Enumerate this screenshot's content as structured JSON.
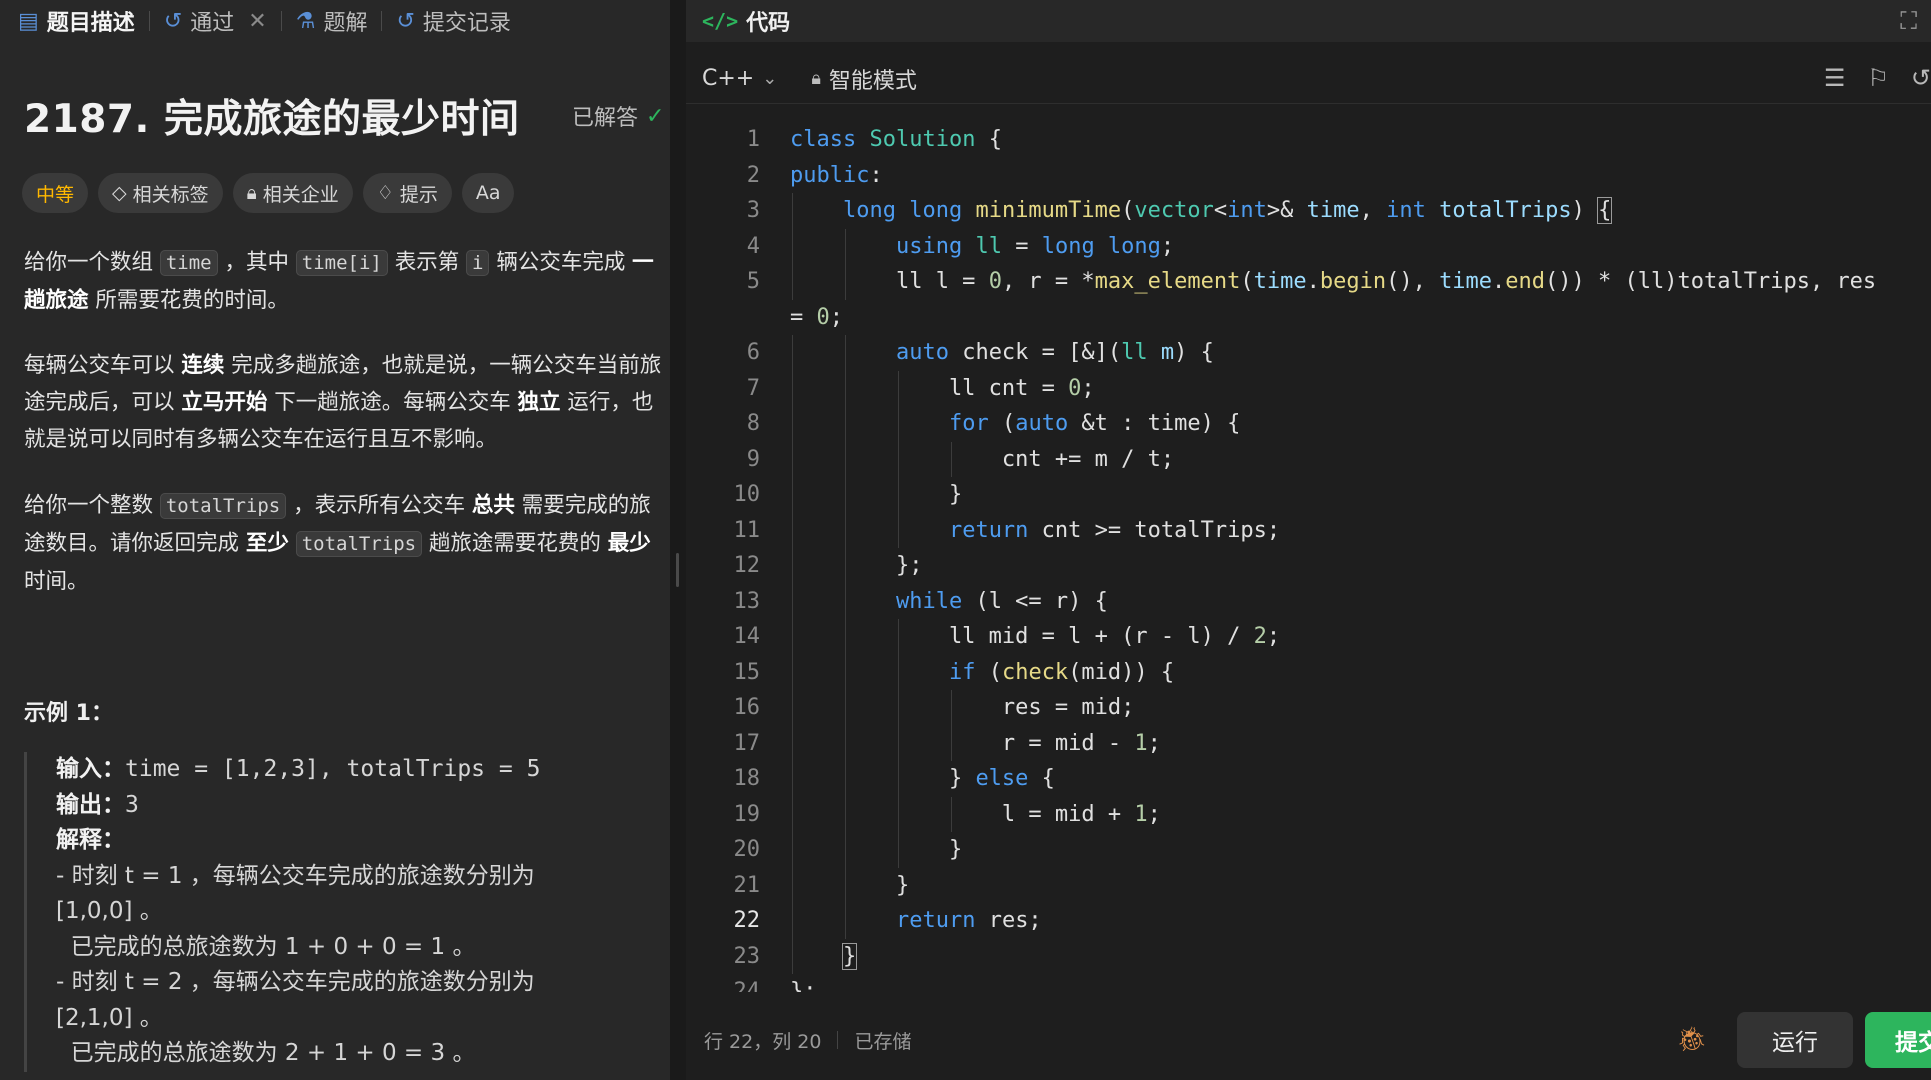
{
  "left_tabs": [
    {
      "label": "题目描述",
      "icon": "doc-icon"
    },
    {
      "label": "通过",
      "icon": "history-icon"
    },
    {
      "label": "题解",
      "icon": "flask-icon"
    },
    {
      "label": "提交记录",
      "icon": "history-icon"
    }
  ],
  "problem": {
    "title": "2187. 完成旅途的最少时间",
    "status": "已解答",
    "difficulty": "中等",
    "tags": [
      "相关标签",
      "相关企业",
      "提示",
      "Aa"
    ]
  },
  "description": {
    "p1_a": "给你一个数组 ",
    "p1_code1": "time",
    "p1_b": " ，其中 ",
    "p1_code2": "time[i]",
    "p1_c": " 表示第 ",
    "p1_code3": "i",
    "p1_d": " 辆公交车完成 ",
    "p1_bold": "一趟旅途",
    "p1_e": " 所需要花费的时间。",
    "p2_a": "每辆公交车可以 ",
    "p2_b1": "连续",
    "p2_b": " 完成多趟旅途，也就是说，一辆公交车当前旅途完成后，可以 ",
    "p2_b2": "立马开始",
    "p2_c": " 下一趟旅途。每辆公交车 ",
    "p2_b3": "独立",
    "p2_d": " 运行，也就是说可以同时有多辆公交车在运行且互不影响。",
    "p3_a": "给你一个整数 ",
    "p3_code1": "totalTrips",
    "p3_b": " ，表示所有公交车 ",
    "p3_b1": "总共",
    "p3_c": " 需要完成的旅途数目。请你返回完成 ",
    "p3_b2": "至少",
    "p3_code2": "totalTrips",
    "p3_d": " 趟旅途需要花费的 ",
    "p3_b3": "最少",
    "p3_e": " 时间。"
  },
  "example": {
    "title": "示例 1：",
    "input_label": "输入：",
    "input_value": "time = [1,2,3], totalTrips = 5",
    "output_label": "输出：",
    "output_value": "3",
    "explain_label": "解释：",
    "lines": [
      "- 时刻 t = 1 ，每辆公交车完成的旅途数分别为",
      "[1,0,0] 。",
      "  已完成的总旅途数为 1 + 0 + 0 = 1 。",
      "- 时刻 t = 2 ，每辆公交车完成的旅途数分别为",
      "[2,1,0] 。",
      "  已完成的总旅途数为 2 + 1 + 0 = 3 。"
    ]
  },
  "editor": {
    "header": "代码",
    "language": "C++",
    "mode": "智能模式",
    "status_pos": "行 22，列 20",
    "status_saved": "已存储",
    "run_label": "运行",
    "submit_label": "提交",
    "current_line": 22
  }
}
